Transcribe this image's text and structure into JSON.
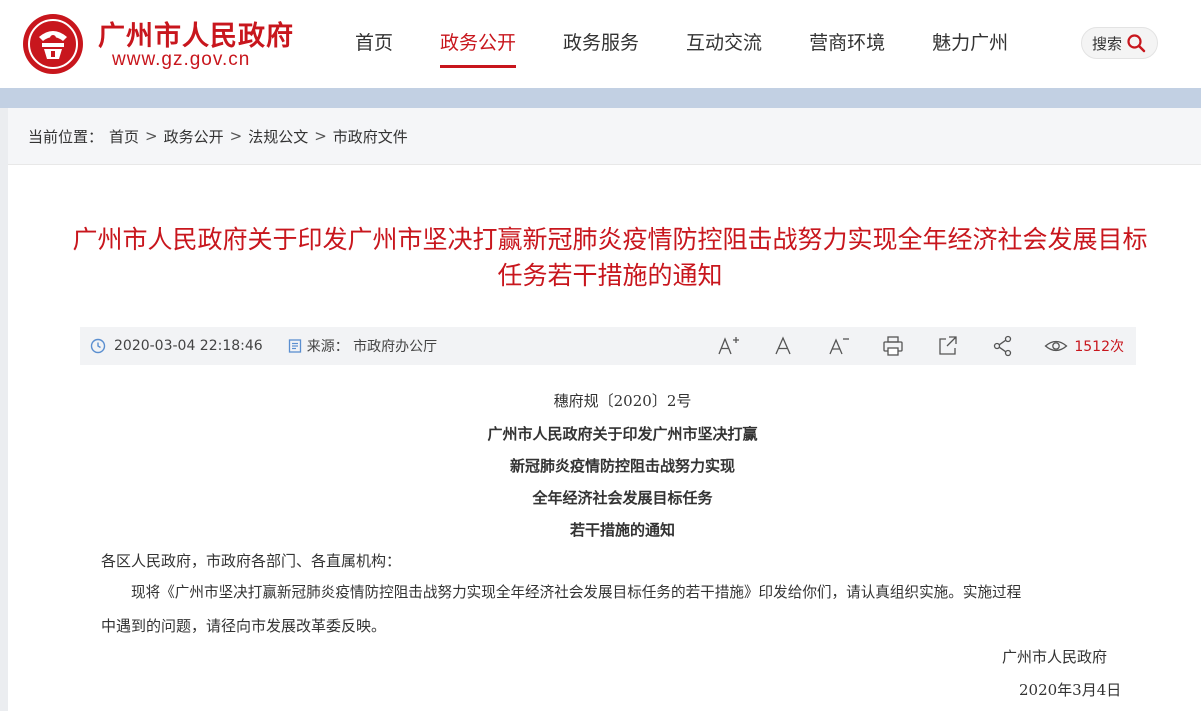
{
  "header": {
    "site_title": "广州市人民政府",
    "site_url": "www.gz.gov.cn",
    "brand_color": "#c8161d",
    "nav": [
      {
        "label": "首页",
        "active": false
      },
      {
        "label": "政务公开",
        "active": true
      },
      {
        "label": "政务服务",
        "active": false
      },
      {
        "label": "互动交流",
        "active": false
      },
      {
        "label": "营商环境",
        "active": false
      },
      {
        "label": "魅力广州",
        "active": false
      }
    ],
    "search_label": "搜索"
  },
  "breadcrumb": {
    "prefix": "当前位置：",
    "items": [
      "首页",
      "政务公开",
      "法规公文",
      "市政府文件"
    ],
    "separator": ">"
  },
  "article": {
    "title_line1": "广州市人民政府关于印发广州市坚决打赢新冠肺炎疫情防控阻击战努力实现全年经济社会发展目标",
    "title_line2": "任务若干措施的通知",
    "meta": {
      "datetime": "2020-03-04 22:18:46",
      "source": "来源：  市政府办公厅",
      "views": "1512次"
    },
    "doc_number": "穗府规〔2020〕2号",
    "heading_lines": [
      "广州市人民政府关于印发广州市坚决打赢",
      "新冠肺炎疫情防控阻击战努力实现",
      "全年经济社会发展目标任务",
      "若干措施的通知"
    ],
    "salutation": "各区人民政府，市政府各部门、各直属机构：",
    "body_line1": "现将《广州市坚决打赢新冠肺炎疫情防控阻击战努力实现全年经济社会发展目标任务的若干措施》印发给你们，请认真组织实施。实施过程",
    "body_line2": "中遇到的问题，请径向市发展改革委反映。",
    "signature": "广州市人民政府",
    "sign_date": "2020年3月4日"
  },
  "icons": {
    "emblem": "emblem-icon",
    "search": "search-icon",
    "clock": "clock-icon",
    "source": "document-icon",
    "font_large": "font-increase-icon",
    "font_medium": "font-default-icon",
    "font_small": "font-decrease-icon",
    "print": "print-icon",
    "share_out": "export-icon",
    "share": "share-icon",
    "views": "eye-icon"
  }
}
